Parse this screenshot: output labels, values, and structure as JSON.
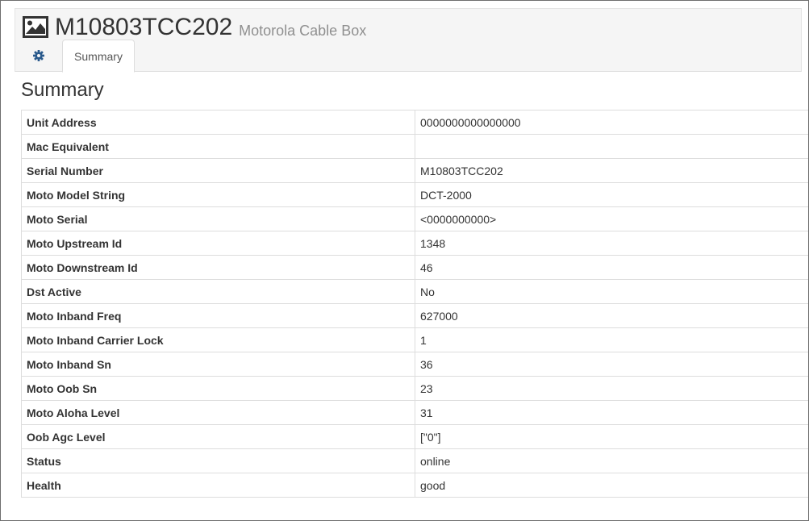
{
  "header": {
    "device_name": "M10803TCC202",
    "device_type": "Motorola Cable Box",
    "icon": "image-icon"
  },
  "tabs": [
    {
      "icon": "gear-icon",
      "label": ""
    },
    {
      "label": "Summary",
      "active": true
    }
  ],
  "section": {
    "title": "Summary"
  },
  "summary": {
    "rows": [
      {
        "label": "Unit Address",
        "value": "0000000000000000"
      },
      {
        "label": "Mac Equivalent",
        "value": ""
      },
      {
        "label": "Serial Number",
        "value": "M10803TCC202"
      },
      {
        "label": "Moto Model String",
        "value": "DCT-2000"
      },
      {
        "label": "Moto Serial",
        "value": "<0000000000>"
      },
      {
        "label": "Moto Upstream Id",
        "value": "1348"
      },
      {
        "label": "Moto Downstream Id",
        "value": "46"
      },
      {
        "label": "Dst Active",
        "value": "No"
      },
      {
        "label": "Moto Inband Freq",
        "value": "627000"
      },
      {
        "label": "Moto Inband Carrier Lock",
        "value": "1"
      },
      {
        "label": "Moto Inband Sn",
        "value": "36"
      },
      {
        "label": "Moto Oob Sn",
        "value": "23"
      },
      {
        "label": "Moto Aloha Level",
        "value": "31"
      },
      {
        "label": "Oob Agc Level",
        "value": "[\"0\"]"
      },
      {
        "label": "Status",
        "value": "online"
      },
      {
        "label": "Health",
        "value": "good"
      }
    ]
  },
  "colors": {
    "gear_icon": "#2a5a8c",
    "subtitle": "#8f8f8f",
    "border": "#dddddd",
    "header_bg": "#f5f5f5"
  }
}
